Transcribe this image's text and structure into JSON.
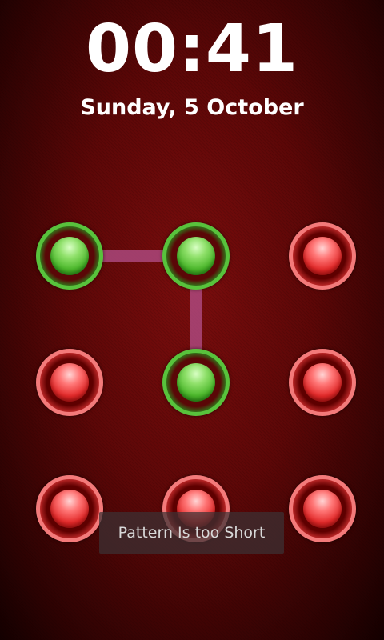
{
  "lockscreen": {
    "time": "00:41",
    "date": "Sunday, 5 October"
  },
  "pattern": {
    "dots": [
      {
        "id": "dot-1",
        "state": "selected"
      },
      {
        "id": "dot-2",
        "state": "selected"
      },
      {
        "id": "dot-3",
        "state": "unselected"
      },
      {
        "id": "dot-4",
        "state": "unselected"
      },
      {
        "id": "dot-5",
        "state": "selected"
      },
      {
        "id": "dot-6",
        "state": "unselected"
      },
      {
        "id": "dot-7",
        "state": "unselected"
      },
      {
        "id": "dot-8",
        "state": "unselected"
      },
      {
        "id": "dot-9",
        "state": "unselected"
      }
    ],
    "entered_sequence": [
      1,
      2,
      5
    ],
    "colors": {
      "selected": "#58c23c",
      "unselected": "#f37a7a",
      "path": "#b4508c"
    }
  },
  "toast": {
    "message": "Pattern Is too Short"
  },
  "background_color": "#5c0707"
}
